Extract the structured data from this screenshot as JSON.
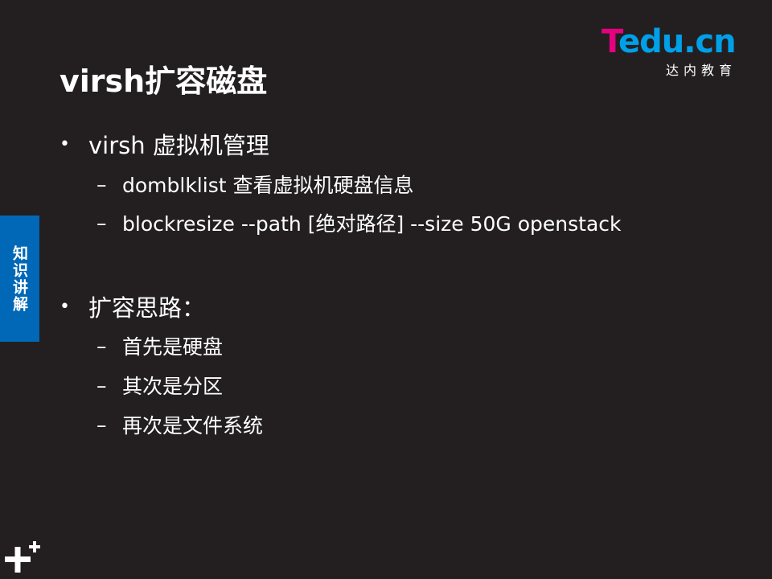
{
  "slide": {
    "title": "virsh扩容磁盘",
    "side_tab": "知识讲解",
    "logo": {
      "word_first": "T",
      "word_rest": "edu.cn",
      "subtitle": "达内教育",
      "colors": {
        "magenta": "#e4007f",
        "blue": "#00a0e9"
      }
    },
    "bullets": [
      {
        "text": "virsh 虚拟机管理",
        "subs": [
          "domblklist 查看虚拟机硬盘信息",
          "blockresize --path  [绝对路径] --size 50G openstack"
        ]
      },
      {
        "text": "扩容思路：",
        "subs": [
          "首先是硬盘",
          "其次是分区",
          "再次是文件系统"
        ]
      }
    ],
    "bullet_symbol": "•",
    "sub_symbol": "–",
    "icons": [
      "plus-plus-icon"
    ],
    "colors": {
      "background": "#231f20",
      "text": "#ffffff",
      "side_tab": "#0068b7"
    }
  }
}
